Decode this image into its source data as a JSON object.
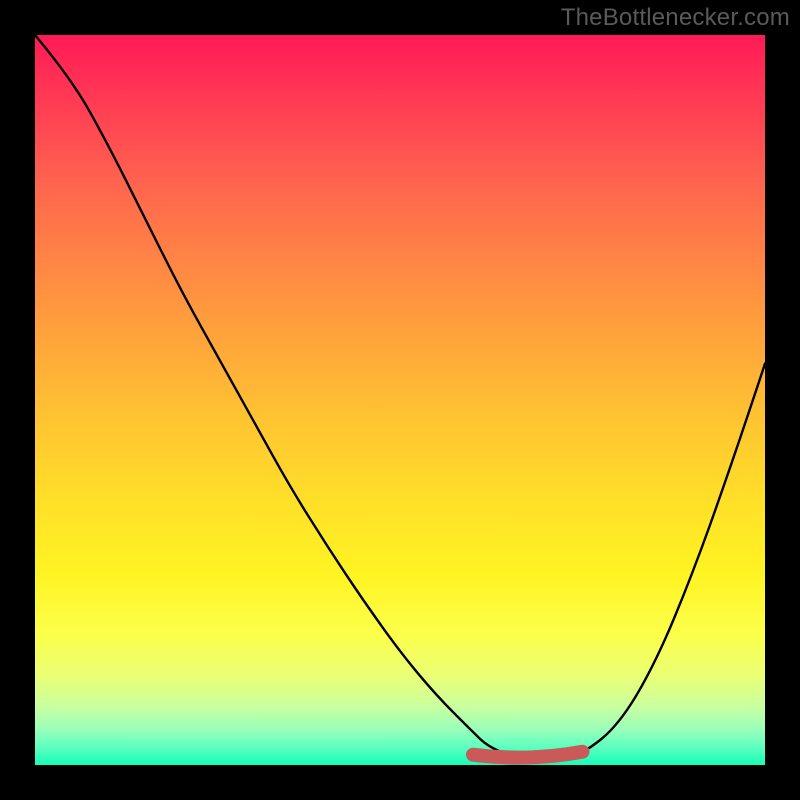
{
  "watermark": {
    "text": "TheBottlenecker.com"
  },
  "colors": {
    "frame": "#000000",
    "watermark": "#5a5a5a",
    "curve": "#000000",
    "marker": "#ca5a5a",
    "gradient_stops": [
      "#ff1a55",
      "#ff3755",
      "#ff6a4d",
      "#ff9a3e",
      "#ffc232",
      "#ffe028",
      "#fff423",
      "#fcff4a",
      "#e9ff76",
      "#c9ffa0",
      "#9cffb8",
      "#5fffc0",
      "#14ffb6"
    ]
  },
  "chart_data": {
    "type": "line",
    "title": "",
    "xlabel": "",
    "ylabel": "",
    "xlim": [
      0,
      100
    ],
    "ylim": [
      0,
      100
    ],
    "grid": false,
    "legend": false,
    "note": "No axis ticks or numeric labels are rendered in the image; x/y are normalized 0–100. y=0 is the bottom (green) band, y=100 is the top (red).",
    "series": [
      {
        "name": "bottleneck-curve",
        "x": [
          0,
          5,
          10,
          15,
          20,
          25,
          30,
          35,
          40,
          45,
          50,
          55,
          60,
          62,
          65,
          68,
          72,
          75,
          80,
          85,
          90,
          95,
          100
        ],
        "y": [
          100,
          94,
          85,
          75,
          65,
          56,
          47,
          38,
          30,
          22.5,
          15.5,
          9.5,
          4.5,
          2.6,
          1.3,
          0.8,
          0.9,
          1.5,
          5.5,
          14,
          26,
          40,
          55
        ]
      }
    ],
    "highlight": {
      "name": "optimal-range",
      "x_range": [
        60,
        75
      ],
      "y_approx": 1.0
    }
  }
}
